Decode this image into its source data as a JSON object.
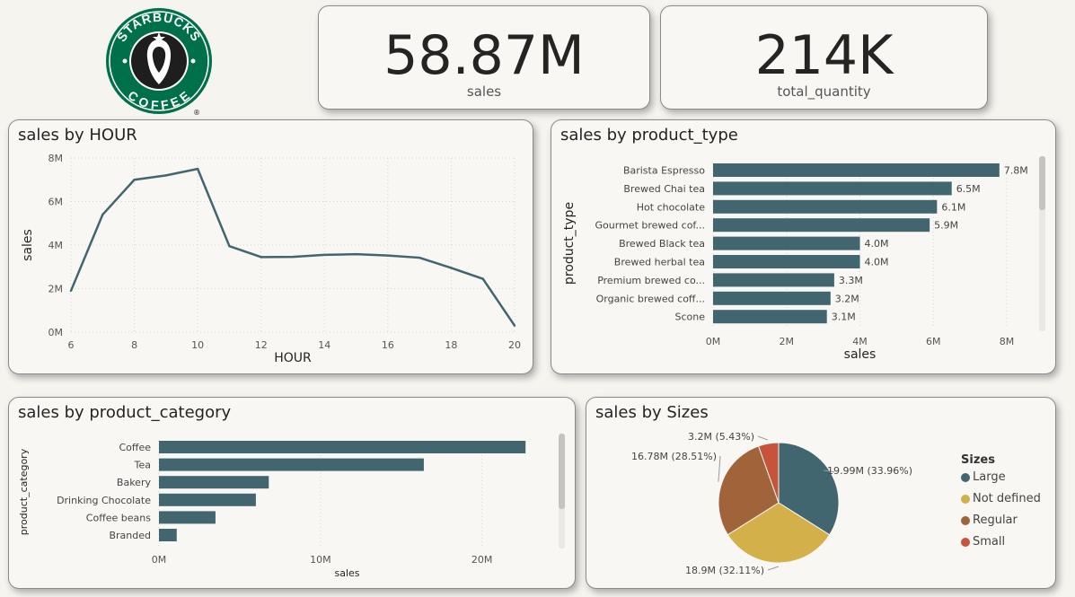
{
  "logo": {
    "top_text": "STARBUCKS",
    "bottom_text": "COFFEE",
    "mark": "®",
    "colors": {
      "green": "#00704a",
      "white": "#ffffff",
      "black": "#1e1e1e"
    }
  },
  "kpis": [
    {
      "value": "58.87M",
      "label": "sales"
    },
    {
      "value": "214K",
      "label": "total_quantity"
    }
  ],
  "colors": {
    "bar": "#41666f",
    "line": "#41666f"
  },
  "chart_data": [
    {
      "type": "line",
      "title": "sales by HOUR",
      "xlabel": "HOUR",
      "ylabel": "sales",
      "x": [
        6,
        7,
        8,
        9,
        10,
        11,
        12,
        13,
        14,
        15,
        16,
        17,
        18,
        19,
        20
      ],
      "values": [
        1.9,
        5.4,
        7.0,
        7.2,
        7.5,
        3.95,
        3.45,
        3.46,
        3.55,
        3.58,
        3.52,
        3.42,
        2.95,
        2.45,
        0.3
      ],
      "xticks": [
        "6",
        "8",
        "10",
        "12",
        "14",
        "16",
        "18",
        "20"
      ],
      "yticks": [
        "0M",
        "2M",
        "4M",
        "6M",
        "8M"
      ],
      "xlim": [
        6,
        20
      ],
      "ylim": [
        0,
        8
      ],
      "grid": true
    },
    {
      "type": "bar",
      "orientation": "horizontal",
      "title": "sales by product_type",
      "xlabel": "sales",
      "ylabel": "product_type",
      "categories": [
        "Barista Espresso",
        "Brewed Chai tea",
        "Hot chocolate",
        "Gourmet brewed cof...",
        "Brewed Black tea",
        "Brewed herbal tea",
        "Premium brewed co...",
        "Organic brewed coff...",
        "Scone"
      ],
      "values": [
        7.8,
        6.5,
        6.1,
        5.9,
        4.0,
        4.0,
        3.3,
        3.2,
        3.1
      ],
      "data_labels": [
        "7.8M",
        "6.5M",
        "6.1M",
        "5.9M",
        "4.0M",
        "4.0M",
        "3.3M",
        "3.2M",
        "3.1M"
      ],
      "xticks": [
        "0M",
        "2M",
        "4M",
        "6M",
        "8M"
      ],
      "xlim": [
        0,
        8
      ],
      "grid": true
    },
    {
      "type": "bar",
      "orientation": "horizontal",
      "title": "sales by product_category",
      "xlabel": "sales",
      "ylabel": "product_category",
      "categories": [
        "Coffee",
        "Tea",
        "Bakery",
        "Drinking Chocolate",
        "Coffee beans",
        "Branded"
      ],
      "values": [
        22.7,
        16.4,
        6.8,
        6.0,
        3.5,
        1.1
      ],
      "xticks": [
        "0M",
        "10M",
        "20M"
      ],
      "xlim": [
        0,
        23.3
      ],
      "grid": true
    },
    {
      "type": "pie",
      "title": "sales by Sizes",
      "legend_title": "Sizes",
      "legend_position": "right",
      "slices": [
        {
          "name": "Large",
          "value": 19.99,
          "percent": 33.96,
          "label": "19.99M (33.96%)",
          "color": "#41666f"
        },
        {
          "name": "Not defined",
          "value": 18.9,
          "percent": 32.11,
          "label": "18.9M (32.11%)",
          "color": "#d4b04a"
        },
        {
          "name": "Regular",
          "value": 16.78,
          "percent": 28.51,
          "label": "16.78M (28.51%)",
          "color": "#a0633a"
        },
        {
          "name": "Small",
          "value": 3.2,
          "percent": 5.43,
          "label": "3.2M (5.43%)",
          "color": "#c5543b"
        }
      ]
    }
  ]
}
